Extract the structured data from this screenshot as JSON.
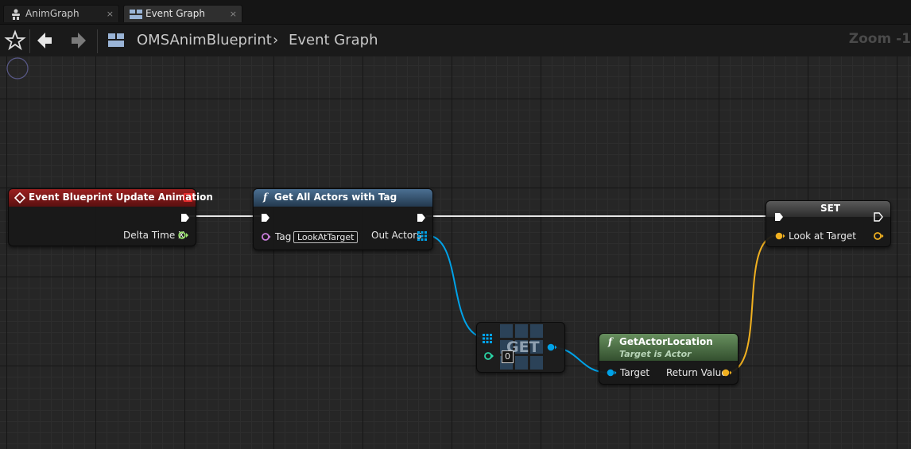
{
  "tabs": [
    {
      "label": "AnimGraph",
      "close": "×",
      "icon": "anim-graph-icon",
      "active": false
    },
    {
      "label": "Event Graph",
      "close": "×",
      "icon": "event-graph-icon",
      "active": true
    }
  ],
  "toolbar": {
    "favorite_icon": "star-icon",
    "back_icon": "back-arrow-icon",
    "forward_icon": "forward-arrow-icon",
    "graph_icon": "graph-icon",
    "breadcrumb": {
      "blueprint": "OMSAnimBlueprint",
      "separator": "›",
      "graph": "Event Graph"
    },
    "zoom": "Zoom -1"
  },
  "nodes": {
    "event_update": {
      "title": "Event Blueprint Update Animation",
      "pin_delta_time": "Delta Time X",
      "header_color": "#8b1a1a"
    },
    "get_all_actors": {
      "title": "Get All Actors with Tag",
      "func_glyph": "f",
      "pin_tag": "Tag",
      "tag_value": "LookAtTarget",
      "pin_out_actors": "Out Actors",
      "header_color": "#3b5a78"
    },
    "get_array": {
      "title": "GET",
      "index_value": "0"
    },
    "get_actor_location": {
      "title": "GetActorLocation",
      "func_glyph": "f",
      "subtitle": "Target is Actor",
      "pin_target": "Target",
      "pin_return": "Return Value",
      "header_color": "#4e6e46"
    },
    "set_node": {
      "title": "SET",
      "pin_look_at": "Look at Target"
    }
  },
  "colors": {
    "exec_wire": "#e8e8e8",
    "object_wire": "#00a2e8",
    "vector_wire": "#f0b020",
    "name_pin": "#c77dd8",
    "float_pin": "#9be36f",
    "int_pin": "#2bd6a7"
  }
}
